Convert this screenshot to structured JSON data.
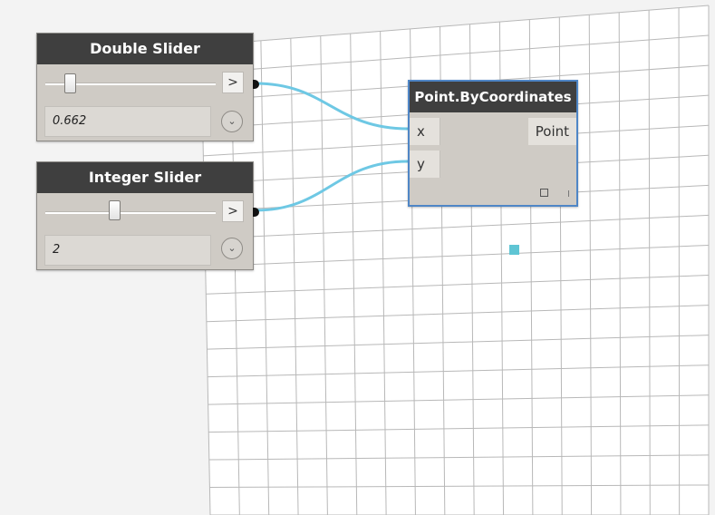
{
  "workspace": {
    "wire_color": "#6ec8e4",
    "point_color": "#5fc5d4",
    "grid_color": "#b8b8b8"
  },
  "double_slider": {
    "title": "Double Slider",
    "value": "0.662",
    "slider_fraction": 0.12,
    "expand_label": ">",
    "chevron_icon": "chevron-down-icon"
  },
  "integer_slider": {
    "title": "Integer Slider",
    "value": "2",
    "slider_fraction": 0.4,
    "expand_label": ">",
    "chevron_icon": "chevron-down-icon"
  },
  "point_node": {
    "title": "Point.ByCoordinates",
    "inputs": [
      "x",
      "y"
    ],
    "output": "Point",
    "preview_icon": "square-outline-icon"
  }
}
